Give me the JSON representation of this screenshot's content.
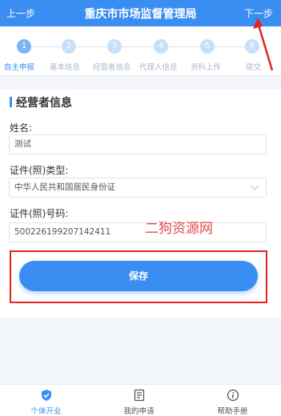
{
  "header": {
    "prev": "上一步",
    "title": "重庆市市场监督管理局",
    "next": "下一步"
  },
  "steps": [
    {
      "num": "1",
      "label": "自主申报"
    },
    {
      "num": "2",
      "label": "基本信息"
    },
    {
      "num": "3",
      "label": "经营者信息"
    },
    {
      "num": "4",
      "label": "代理人信息"
    },
    {
      "num": "5",
      "label": "资料上传"
    },
    {
      "num": "6",
      "label": "提交"
    }
  ],
  "form": {
    "section_title": "经营者信息",
    "name_label": "姓名:",
    "name_value": "测试",
    "id_type_label": "证件(照)类型:",
    "id_type_value": "中华人民共和国居民身份证",
    "id_number_label": "证件(照)号码:",
    "id_number_value": "500226199207142411"
  },
  "watermark": "二狗资源网",
  "save_button": "保存",
  "tabbar": [
    {
      "label": "个体开业",
      "icon": "shield-check-icon"
    },
    {
      "label": "我的申请",
      "icon": "document-list-icon"
    },
    {
      "label": "帮助手册",
      "icon": "info-icon"
    }
  ],
  "colors": {
    "primary": "#3a8ef2",
    "annotation_red": "#e02424"
  }
}
